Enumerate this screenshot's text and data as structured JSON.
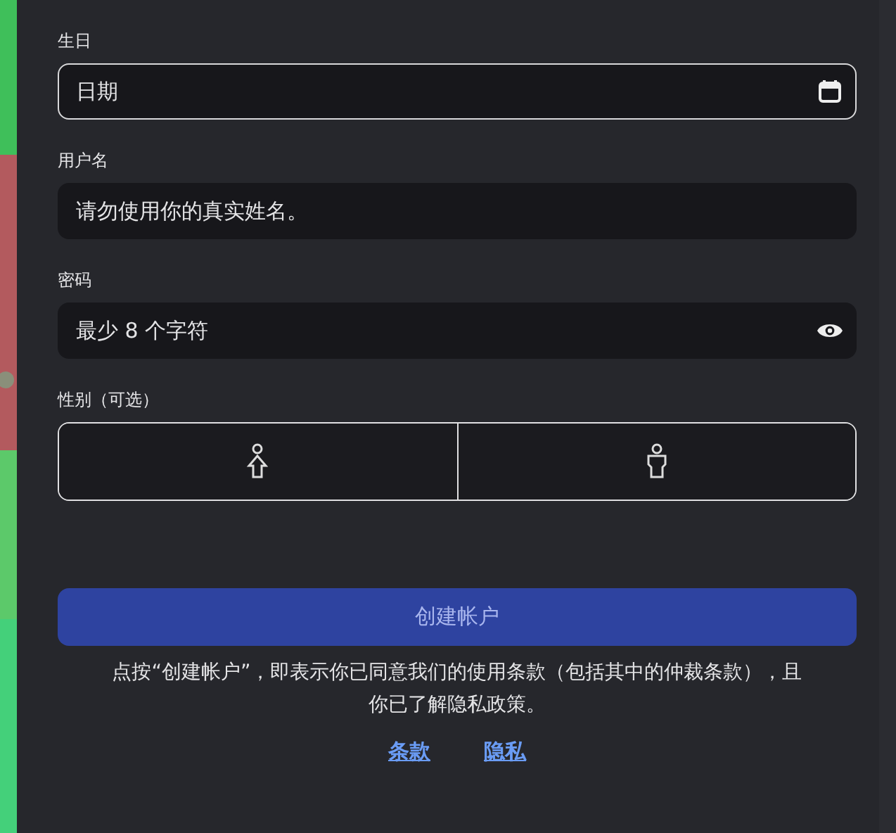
{
  "fields": [
    {
      "label": "生日",
      "placeholder": "日期",
      "kind": "date",
      "focused": true
    },
    {
      "label": "用户名",
      "placeholder": "请勿使用你的真实姓名。",
      "kind": "text",
      "focused": false
    },
    {
      "label": "密码",
      "placeholder": "最少 8 个字符",
      "kind": "password",
      "focused": false
    }
  ],
  "gender": {
    "label": "性别（可选）",
    "options": [
      {
        "kind": "female"
      },
      {
        "kind": "male"
      }
    ]
  },
  "submit": "创建帐户",
  "notice": [
    "点按“创建帐户”，即表示你已同意我们的使用条款（包括其中的仲裁条款），且",
    "你已了解隐私政策。"
  ],
  "links": [
    "条款",
    "隐私"
  ]
}
